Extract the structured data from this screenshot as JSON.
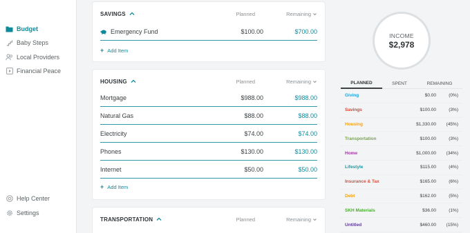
{
  "sidebar": {
    "items": [
      {
        "label": "Budget",
        "icon": "folder-icon",
        "active": true
      },
      {
        "label": "Baby Steps",
        "icon": "steps-icon"
      },
      {
        "label": "Local Providers",
        "icon": "people-icon"
      },
      {
        "label": "Financial Peace",
        "icon": "play-icon"
      }
    ],
    "bottom_items": [
      {
        "label": "Help Center",
        "icon": "help-icon"
      },
      {
        "label": "Settings",
        "icon": "gear-icon"
      }
    ]
  },
  "groups": {
    "savings": {
      "title": "SAVINGS",
      "planned_header": "Planned",
      "remaining_header": "Remaining",
      "items": [
        {
          "name": "Emergency Fund",
          "planned": "$100.00",
          "remaining": "$700.00",
          "icon": "piggy-bank-icon"
        }
      ],
      "add_item": "Add Item"
    },
    "housing": {
      "title": "HOUSING",
      "planned_header": "Planned",
      "remaining_header": "Remaining",
      "items": [
        {
          "name": "Mortgage",
          "planned": "$988.00",
          "remaining": "$988.00"
        },
        {
          "name": "Natural Gas",
          "planned": "$88.00",
          "remaining": "$88.00"
        },
        {
          "name": "Electricity",
          "planned": "$74.00",
          "remaining": "$74.00"
        },
        {
          "name": "Phones",
          "planned": "$130.00",
          "remaining": "$130.00"
        },
        {
          "name": "Internet",
          "planned": "$50.00",
          "remaining": "$50.00"
        }
      ],
      "add_item": "Add Item"
    },
    "transportation": {
      "title": "TRANSPORTATION",
      "planned_header": "Planned",
      "remaining_header": "Remaining"
    }
  },
  "income": {
    "label": "INCOME",
    "value": "$2,978"
  },
  "summary": {
    "tabs": [
      "PLANNED",
      "SPENT",
      "REMAINING"
    ],
    "active_tab": "PLANNED",
    "rows": [
      {
        "category": "Giving",
        "amount": "$0.00",
        "percent": "(0%)",
        "color": "#1e9fd8"
      },
      {
        "category": "Savings",
        "amount": "$100.00",
        "percent": "(3%)",
        "color": "#e0432f"
      },
      {
        "category": "Housing",
        "amount": "$1,330.00",
        "percent": "(45%)",
        "color": "#f0a21b"
      },
      {
        "category": "Transportation",
        "amount": "$100.00",
        "percent": "(3%)",
        "color": "#6fae2e"
      },
      {
        "category": "Home",
        "amount": "$1,000.00",
        "percent": "(34%)",
        "color": "#9a3c9c"
      },
      {
        "category": "Lifestyle",
        "amount": "$115.00",
        "percent": "(4%)",
        "color": "#149aa0"
      },
      {
        "category": "Insurance & Tax",
        "amount": "$165.00",
        "percent": "(6%)",
        "color": "#dc4a3a"
      },
      {
        "category": "Debt",
        "amount": "$162.00",
        "percent": "(5%)",
        "color": "#f0a21b"
      },
      {
        "category": "SKH Materials",
        "amount": "$36.00",
        "percent": "(1%)",
        "color": "#4caa35"
      },
      {
        "category": "Untitled",
        "amount": "$460.00",
        "percent": "(15%)",
        "color": "#5a3c8c"
      }
    ]
  },
  "colors": {
    "accent": "#0e8b9b",
    "rule": "#2c9aa5"
  }
}
